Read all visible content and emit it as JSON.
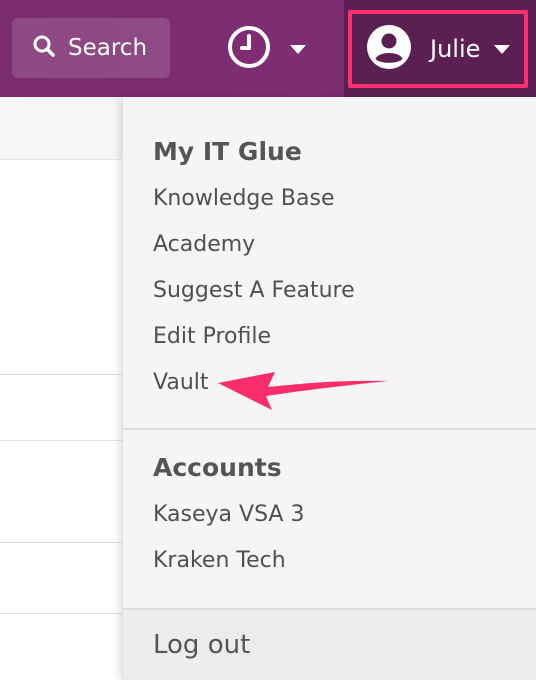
{
  "topbar": {
    "search_label": "Search",
    "user_name": "Julie"
  },
  "menu": {
    "section1_title": "My IT Glue",
    "items1": [
      "Knowledge Base",
      "Academy",
      "Suggest A Feature",
      "Edit Profile",
      "Vault"
    ],
    "section2_title": "Accounts",
    "items2": [
      "Kaseya VSA 3",
      "Kraken Tech"
    ],
    "logout_label": "Log out"
  },
  "colors": {
    "nav_bg": "#7e2d72",
    "user_bg": "#5c1f52",
    "highlight": "#ff2f6d"
  },
  "icons": {
    "search": "search-icon",
    "clock": "clock-icon",
    "user": "user-circle-icon",
    "caret": "caret-down-icon"
  }
}
